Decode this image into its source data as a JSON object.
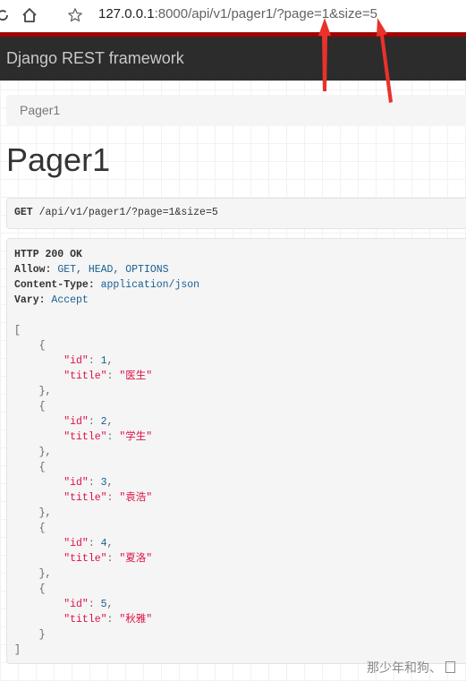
{
  "browser": {
    "url_host": "127.0.0.1",
    "url_rest": ":8000/api/v1/pager1/?page=1&size=5"
  },
  "navbar": {
    "brand": "Django REST framework"
  },
  "breadcrumb": {
    "item": "Pager1"
  },
  "page_title": "Pager1",
  "request": {
    "method": "GET",
    "path": "/api/v1/pager1/?page=1&size=5"
  },
  "response": {
    "status": "HTTP 200 OK",
    "headers": [
      {
        "name": "Allow:",
        "value": "GET, HEAD, OPTIONS"
      },
      {
        "name": "Content-Type:",
        "value": "application/json"
      },
      {
        "name": "Vary:",
        "value": "Accept"
      }
    ],
    "items": [
      {
        "id": "1",
        "title": "\"医生\""
      },
      {
        "id": "2",
        "title": "\"学生\""
      },
      {
        "id": "3",
        "title": "\"袁浩\""
      },
      {
        "id": "4",
        "title": "\"夏洛\""
      },
      {
        "id": "5",
        "title": "\"秋雅\""
      }
    ],
    "key_id": "\"id\"",
    "key_title": "\"title\""
  },
  "watermark": "那少年和狗、",
  "colors": {
    "navbar_bg": "#2c2c2c",
    "navbar_accent": "#a30000",
    "annotation_arrow": "#e8322b"
  },
  "icons": [
    "reload-icon",
    "home-icon",
    "star-icon"
  ]
}
